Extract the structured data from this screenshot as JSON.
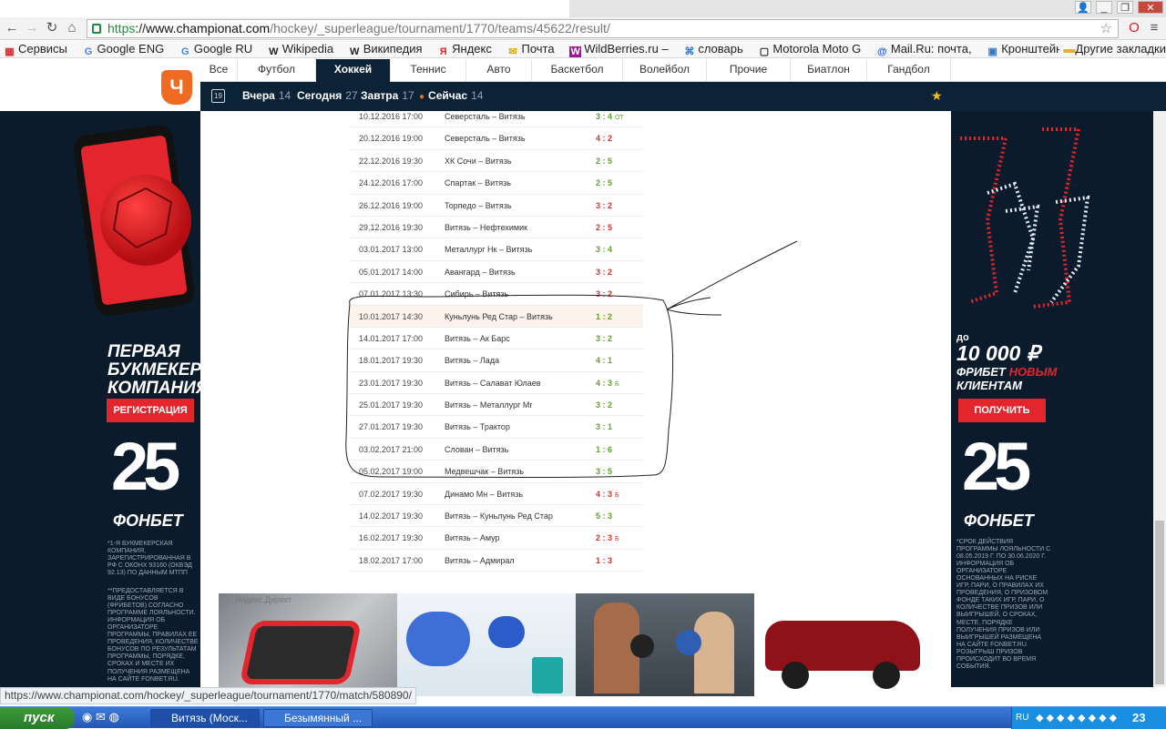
{
  "browser": {
    "url_proto": "https",
    "url_host": "www.championat.com",
    "url_path": "/hockey/_superleague/tournament/1770/teams/45622/result/",
    "bookmarks": [
      "Сервисы",
      "Google ENG",
      "Google RU",
      "Wikipedia",
      "Википедия",
      "Яндекс",
      "Почта",
      "WildBerries.ru –",
      "словарь",
      "Motorola Moto G",
      "Mail.Ru: почта,",
      "Кронштейн ме"
    ],
    "other_bookmarks": "Другие закладки",
    "status_url": "https://www.championat.com/hockey/_superleague/tournament/1770/match/580890/"
  },
  "site": {
    "logo_letter": "Ч",
    "sports": [
      "Все",
      "Футбол",
      "Хоккей",
      "Теннис",
      "Авто",
      "Баскетбол",
      "Волейбол",
      "Прочие",
      "Биатлон",
      "Гандбол"
    ],
    "active_sport": "Хоккей",
    "calendar_day": "19",
    "days": [
      {
        "label": "Вчера",
        "count": "14"
      },
      {
        "label": "Сегодня",
        "count": "27"
      },
      {
        "label": "Завтра",
        "count": "17"
      },
      {
        "label": "Сейчас",
        "count": "14"
      }
    ]
  },
  "matches": [
    {
      "date": "10.12.2016 17:00",
      "teams": "Северсталь – Витязь",
      "score": "3 : 4",
      "extra": "ОТ",
      "result": "win"
    },
    {
      "date": "20.12.2016 19:00",
      "teams": "Северсталь – Витязь",
      "score": "4 : 2",
      "extra": "",
      "result": "loss"
    },
    {
      "date": "22.12.2016 19:30",
      "teams": "ХК Сочи – Витязь",
      "score": "2 : 5",
      "extra": "",
      "result": "win"
    },
    {
      "date": "24.12.2016 17:00",
      "teams": "Спартак – Витязь",
      "score": "2 : 5",
      "extra": "",
      "result": "win"
    },
    {
      "date": "26.12.2016 19:00",
      "teams": "Торпедо – Витязь",
      "score": "3 : 2",
      "extra": "",
      "result": "loss"
    },
    {
      "date": "29.12.2016 19:30",
      "teams": "Витязь – Нефтехимик",
      "score": "2 : 5",
      "extra": "",
      "result": "loss"
    },
    {
      "date": "03.01.2017 13:00",
      "teams": "Металлург Нк – Витязь",
      "score": "3 : 4",
      "extra": "",
      "result": "win"
    },
    {
      "date": "05.01.2017 14:00",
      "teams": "Авангард – Витязь",
      "score": "3 : 2",
      "extra": "",
      "result": "loss"
    },
    {
      "date": "07.01.2017 13:30",
      "teams": "Сибирь – Витязь",
      "score": "3 : 2",
      "extra": "",
      "result": "loss"
    },
    {
      "date": "10.01.2017 14:30",
      "teams": "Куньлунь Ред Стар – Витязь",
      "score": "1 : 2",
      "extra": "",
      "result": "win",
      "highlight": true
    },
    {
      "date": "14.01.2017 17:00",
      "teams": "Витязь – Ак Барс",
      "score": "3 : 2",
      "extra": "",
      "result": "win"
    },
    {
      "date": "18.01.2017 19:30",
      "teams": "Витязь – Лада",
      "score": "4 : 1",
      "extra": "",
      "result": "win"
    },
    {
      "date": "23.01.2017 19:30",
      "teams": "Витязь – Салават Юлаев",
      "score": "4 : 3",
      "extra": "Б",
      "result": "win"
    },
    {
      "date": "25.01.2017 19:30",
      "teams": "Витязь – Металлург Мг",
      "score": "3 : 2",
      "extra": "",
      "result": "win"
    },
    {
      "date": "27.01.2017 19:30",
      "teams": "Витязь – Трактор",
      "score": "3 : 1",
      "extra": "",
      "result": "win"
    },
    {
      "date": "03.02.2017 21:00",
      "teams": "Слован – Витязь",
      "score": "1 : 6",
      "extra": "",
      "result": "win"
    },
    {
      "date": "05.02.2017 19:00",
      "teams": "Медвешчак – Витязь",
      "score": "3 : 5",
      "extra": "",
      "result": "win"
    },
    {
      "date": "07.02.2017 19:30",
      "teams": "Динамо Мн – Витязь",
      "score": "4 : 3",
      "extra": "Б",
      "result": "loss"
    },
    {
      "date": "14.02.2017 19:30",
      "teams": "Витязь – Куньлунь Ред Стар",
      "score": "5 : 3",
      "extra": "",
      "result": "win"
    },
    {
      "date": "16.02.2017 19:30",
      "teams": "Витязь – Амур",
      "score": "2 : 3",
      "extra": "Б",
      "result": "loss"
    },
    {
      "date": "18.02.2017 17:00",
      "teams": "Витязь – Адмирал",
      "score": "1 : 3",
      "extra": "",
      "result": "loss"
    }
  ],
  "ads": {
    "left_headline": "ПЕРВАЯ БУКМЕКЕРСКАЯ КОМПАНИЯ",
    "left_button": "РЕГИСТРАЦИЯ",
    "brand_number": "25",
    "brand_name": "ФОНБЕТ",
    "left_small1": "*1-я букмекерская компания, зарегистрированная в РФ с ОКОНХ 93160 (ОКВЭД 92.13) по данным МТПП",
    "left_small2": "**Предоставляется в виде бонусов (фрибетов) согласно программе лояльности. Информация об организаторе программы, правилах ее проведения, количестве бонусов по результатам программы, порядке, сроках и месте их получения размещена на сайте FONBET.RU.",
    "right_prefix": "до",
    "right_amount": "10 000 ₽",
    "right_line1": "ФРИБЕТ",
    "right_line1b": "НОВЫМ",
    "right_line2": "КЛИЕНТАМ",
    "right_button": "ПОЛУЧИТЬ",
    "right_small": "*Срок действия программы лояльности с 08.05.2019 г. по 30.06.2020 г. Информация об организаторе основанных на риске игр, пари, о правилах их проведения, о призовом фонде таких игр, пари, о количестве призов или выигрышей, о сроках, месте, порядке получения призов или выигрышей размещена на сайте FONBET.RU. Розыгрыш призов происходит во время события.",
    "yandex_label": "Яндекс.Директ"
  },
  "taskbar": {
    "start": "пуск",
    "tasks": [
      "Витязь (Моск...",
      "Безымянный ..."
    ],
    "lang": "RU",
    "time": "23"
  },
  "colors": {
    "navy": "#0c2237",
    "win": "#5ea327",
    "loss": "#d9302b",
    "accent": "#f06a22",
    "fonbet_red": "#e3262d"
  }
}
